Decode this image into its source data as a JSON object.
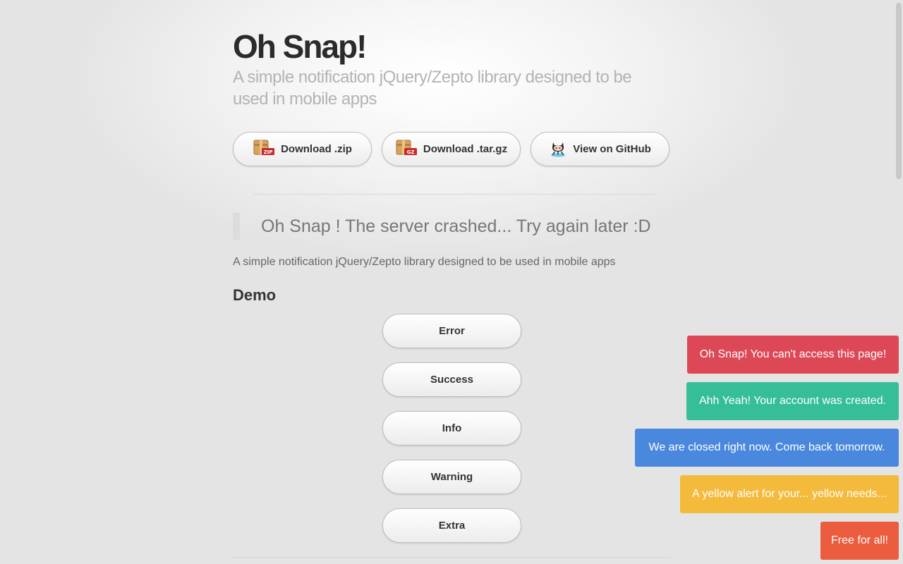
{
  "header": {
    "title": "Oh Snap!",
    "subtitle": "A simple notification jQuery/Zepto library designed to be used in mobile apps"
  },
  "downloads": {
    "zip": {
      "label": "Download .zip",
      "icon": "zip-archive-icon",
      "badge": "ZIP"
    },
    "targz": {
      "label": "Download .tar.gz",
      "icon": "gz-archive-icon",
      "badge": "GZ"
    },
    "github": {
      "label": "View on GitHub",
      "icon": "octocat-icon"
    }
  },
  "quote": "Oh Snap ! The server crashed... Try again later :D",
  "description": "A simple notification jQuery/Zepto library designed to be used in mobile apps",
  "demo": {
    "heading": "Demo",
    "buttons": [
      "Error",
      "Success",
      "Info",
      "Warning",
      "Extra"
    ]
  },
  "notifications": [
    {
      "type": "error",
      "text": "Oh Snap! You can't access this page!",
      "color": "#dd4857"
    },
    {
      "type": "success",
      "text": "Ahh Yeah! Your account was created.",
      "color": "#36be98"
    },
    {
      "type": "info",
      "text": "We are closed right now. Come back tomorrow.",
      "color": "#4a88dd"
    },
    {
      "type": "warning",
      "text": "A yellow alert for your... yellow needs...",
      "color": "#f4ba3c"
    },
    {
      "type": "extra",
      "text": "Free for all!",
      "color": "#ec5c3f"
    }
  ]
}
